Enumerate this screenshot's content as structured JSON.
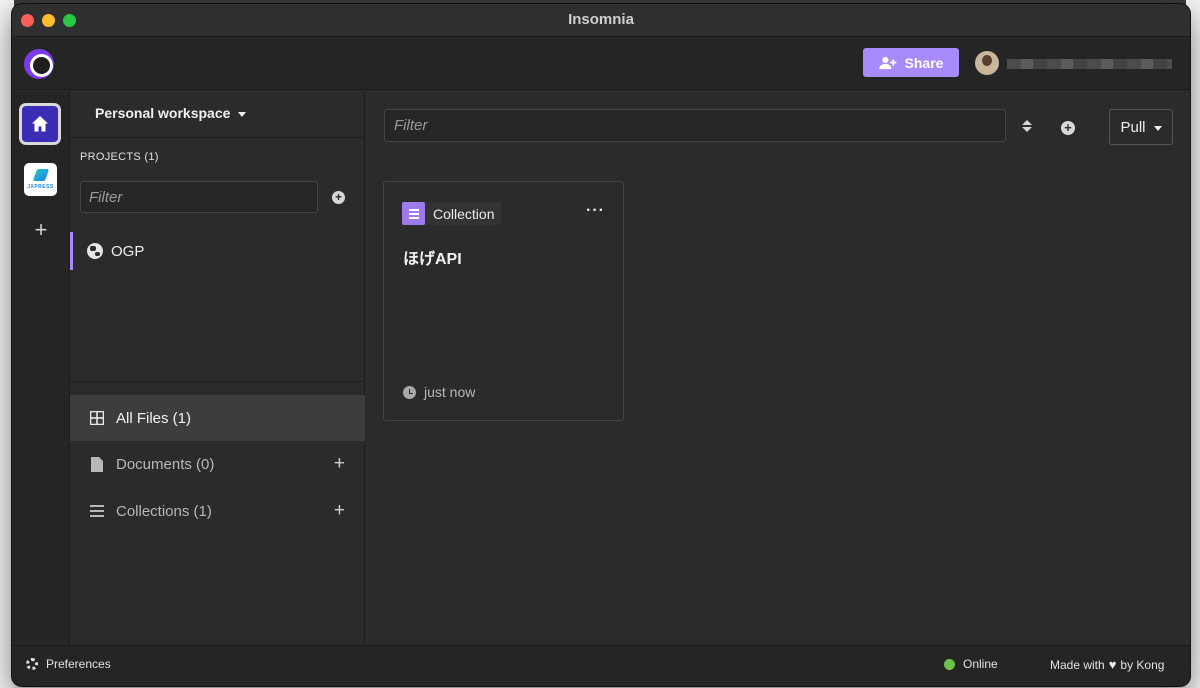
{
  "window": {
    "title": "Insomnia"
  },
  "header": {
    "share_label": "Share"
  },
  "workspace": {
    "title": "Personal workspace"
  },
  "projects": {
    "label": "PROJECTS (1)",
    "filter_placeholder": "Filter",
    "items": [
      {
        "label": "OGP"
      }
    ]
  },
  "nav": {
    "all_files": "All Files (1)",
    "documents": "Documents (0)",
    "collections": "Collections (1)"
  },
  "main": {
    "filter_placeholder": "Filter",
    "pull_label": "Pull",
    "cards": [
      {
        "type_label": "Collection",
        "title": "ほげAPI",
        "time": "just now"
      }
    ]
  },
  "status": {
    "preferences": "Preferences",
    "online": "Online",
    "made_with_prefix": "Made with",
    "made_with_suffix": "by Kong"
  },
  "org": {
    "logo_text": "JXPRESS"
  },
  "colors": {
    "accent": "#a78bfa",
    "online": "#6cc24a",
    "home_bg": "#3b2db4"
  }
}
